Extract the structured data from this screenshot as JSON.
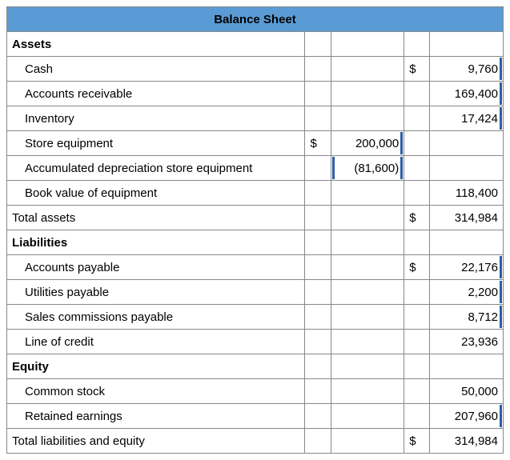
{
  "title": "Balance Sheet",
  "sections": {
    "assets": {
      "heading": "Assets",
      "cash": {
        "label": "Cash",
        "sym": "$",
        "value": "9,760"
      },
      "ar": {
        "label": "Accounts receivable",
        "value": "169,400"
      },
      "inventory": {
        "label": "Inventory",
        "value": "17,424"
      },
      "equipment": {
        "label": "Store equipment",
        "sym": "$",
        "value": "200,000"
      },
      "accdep": {
        "label": "Accumulated depreciation store equipment",
        "value": "(81,600)"
      },
      "bookval": {
        "label": "Book value of equipment",
        "value": "118,400"
      },
      "total": {
        "label": "Total assets",
        "sym": "$",
        "value": "314,984"
      }
    },
    "liabilities": {
      "heading": "Liabilities",
      "ap": {
        "label": "Accounts payable",
        "sym": "$",
        "value": "22,176"
      },
      "utilities": {
        "label": "Utilities payable",
        "value": "2,200"
      },
      "commissions": {
        "label": "Sales commissions payable",
        "value": "8,712"
      },
      "loc": {
        "label": "Line of credit",
        "value": "23,936"
      }
    },
    "equity": {
      "heading": "Equity",
      "common": {
        "label": "Common stock",
        "value": "50,000"
      },
      "retained": {
        "label": "Retained earnings",
        "value": "207,960"
      },
      "total": {
        "label": "Total liabilities and equity",
        "sym": "$",
        "value": "314,984"
      }
    }
  }
}
